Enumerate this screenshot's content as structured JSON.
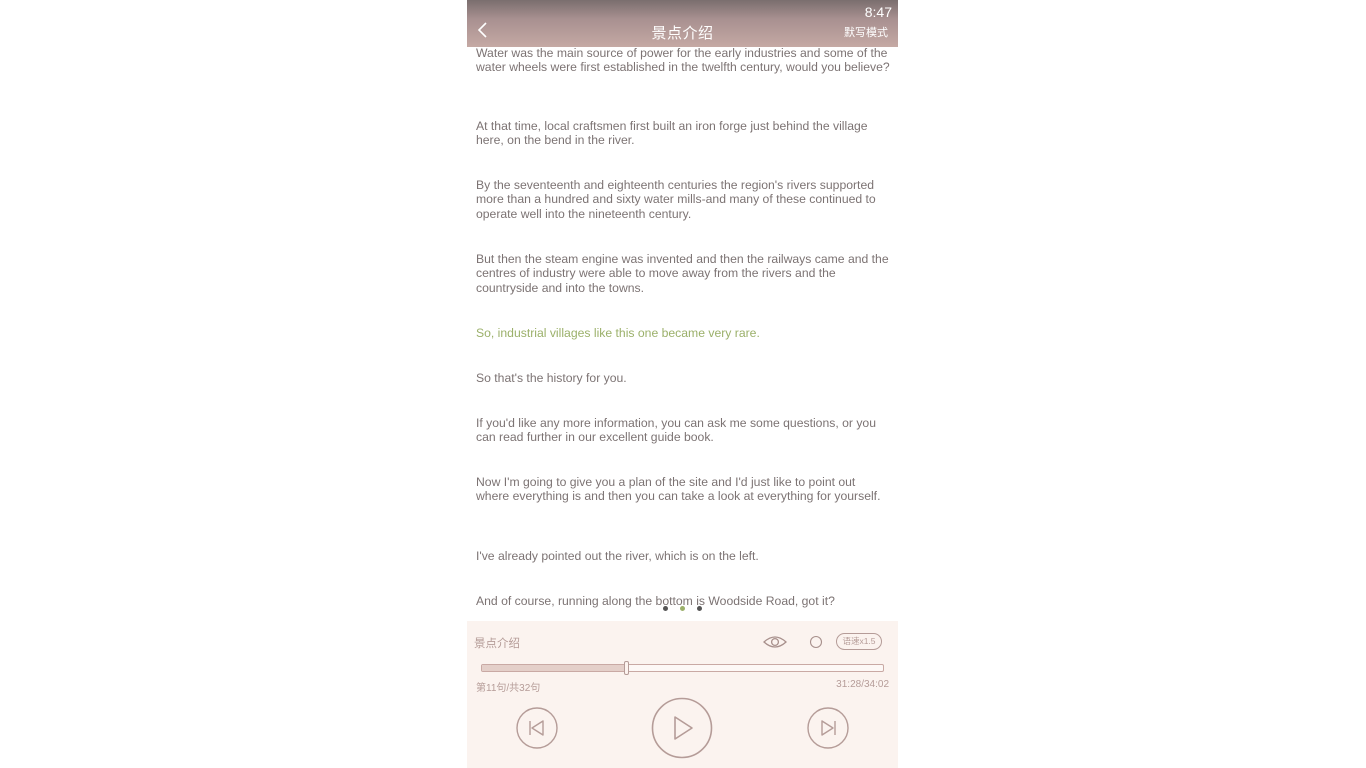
{
  "status": {
    "time": "8:47"
  },
  "header": {
    "title": "景点介绍",
    "mode": "默写模式"
  },
  "paragraphs": [
    "Water was the main source of power for the early industries and some of the water wheels were first established in the twelfth century, would you believe?",
    "At that time, local craftsmen first built an iron forge just behind the village here, on the bend in the river.",
    "By the seventeenth and eighteenth centuries the region's rivers supported more than a hundred and sixty water mills-and many of these continued to operate well into the nineteenth century.",
    "But then the steam engine was invented and then the railways came and the centres of industry were able to move away from the rivers and the countryside and into the towns.",
    "So, industrial villages like this one became very rare.",
    "So that's the history for you.",
    "If you'd like any more information, you can ask me some questions, or you can read further in our excellent guide book.",
    "Now I'm going to give you a plan of the site and I'd just like to point out where everything is and then you can take a look at everything for yourself.",
    "I've already pointed out the river, which is on the left.",
    "And of course, running along the bottom is Woodside Road, got it?"
  ],
  "active_paragraph": 4,
  "pager": {
    "pages": 3,
    "active": 1
  },
  "player": {
    "label": "景点介绍",
    "speed": "语速x1.5",
    "progress": 0.36,
    "sentence_counter": "第11句/共32句",
    "time": "31:28/34:02"
  },
  "icons": [
    "back-arrow-icon",
    "eye-icon",
    "loop-icon",
    "previous-icon",
    "play-icon",
    "next-icon"
  ],
  "colors": {
    "accent": "#9bb06a",
    "player_ui": "#b59c98",
    "text": "#7c7373"
  }
}
